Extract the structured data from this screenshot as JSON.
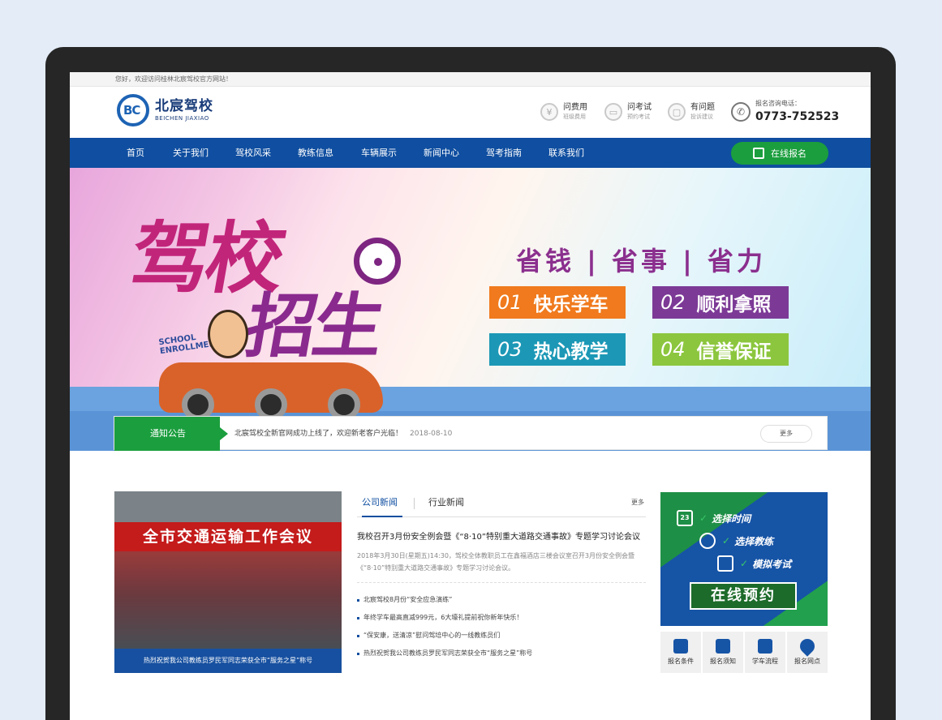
{
  "topbar": {
    "welcome": "您好，欢迎访问桂林北宸驾校官方网站！"
  },
  "logo": {
    "name_cn": "北宸驾校",
    "name_en": "BEICHEN JIAXIAO"
  },
  "header_links": [
    {
      "title": "问费用",
      "sub": "班级费用",
      "icon": "money-icon"
    },
    {
      "title": "问考试",
      "sub": "预约考试",
      "icon": "car-icon"
    },
    {
      "title": "有问题",
      "sub": "投诉建议",
      "icon": "chat-icon"
    }
  ],
  "hotline": {
    "label": "报名咨询电话：",
    "number": "0773-752523"
  },
  "nav": {
    "items": [
      "首页",
      "关于我们",
      "驾校风采",
      "教练信息",
      "车辆展示",
      "新闻中心",
      "驾考指南",
      "联系我们"
    ],
    "signup_label": "在线报名"
  },
  "banner": {
    "title_line1": "驾校",
    "title_line2": "招生",
    "badge_line1": "SCHOOL",
    "badge_line2": "ENROLLMENT",
    "slogan": "省钱 | 省事 | 省力",
    "features": [
      {
        "num": "01",
        "text": "快乐学车",
        "color": "#f07a1d"
      },
      {
        "num": "02",
        "text": "顺利拿照",
        "color": "#7c3a96"
      },
      {
        "num": "03",
        "text": "热心教学",
        "color": "#1c98b6"
      },
      {
        "num": "04",
        "text": "信誉保证",
        "color": "#8cc63e"
      }
    ]
  },
  "notice": {
    "label": "通知公告",
    "text": "北宸驾校全新官网成功上线了，欢迎新老客户光临！",
    "date": "2018-08-10",
    "more": "更多"
  },
  "photo": {
    "banner_text": "全市交通运输工作会议",
    "caption": "热烈祝贺我公司教练员罗民军同志荣获全市“服务之星”称号"
  },
  "news": {
    "tabs": [
      "公司新闻",
      "行业新闻"
    ],
    "more": "更多",
    "headline": "我校召开3月份安全例会暨《“8·10”特别重大道路交通事故》专题学习讨论会议",
    "summary": "2018年3月30日(星期五)14:30，驾校全体教职员工在鑫福酒店三楼会议室召开3月份安全例会暨《“8·10”特别重大道路交通事故》专题学习讨论会议。",
    "items": [
      "北宸驾校8月份“安全应急演练”",
      "年终学车最高直减999元，6大壕礼提前祝你新年快乐！",
      "“保安康，送清凉”慰问驾培中心的一线教练员们",
      "热烈祝贺我公司教练员罗民军同志荣获全市“服务之星”称号"
    ]
  },
  "booking": {
    "items": [
      "选择时间",
      "选择教练",
      "模拟考试"
    ],
    "calendar_day": "23",
    "button": "在线预约"
  },
  "quick_links": [
    "报名条件",
    "报名须知",
    "学车流程",
    "报名网点"
  ]
}
